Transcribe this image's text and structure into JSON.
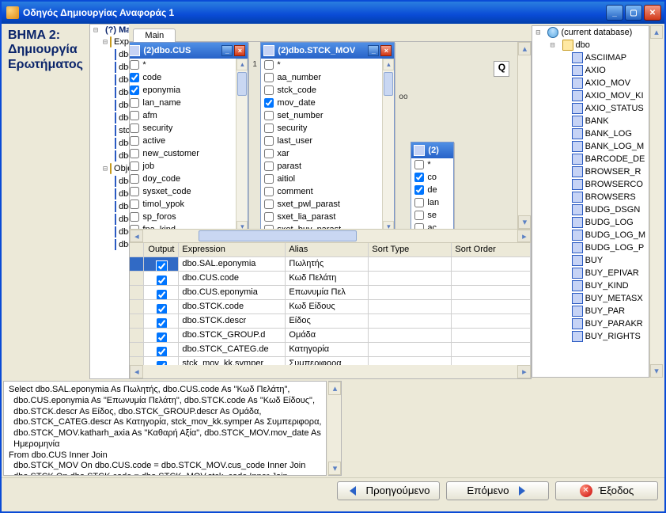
{
  "window": {
    "title": "Οδηγός Δημιουργίας Αναφοράς 1"
  },
  "wizard": {
    "step_title_line1": "BHMA 2:",
    "step_title_line2": "Δημιουργία",
    "step_title_line3": "Ερωτήματος"
  },
  "mid_tree": {
    "root": "(?) Main",
    "items": [
      {
        "indent": 1,
        "icon": "fold",
        "label": "Express"
      },
      {
        "indent": 2,
        "icon": "tab",
        "label": "dbo"
      },
      {
        "indent": 2,
        "icon": "tab",
        "label": "dbo"
      },
      {
        "indent": 2,
        "icon": "tab",
        "label": "dbo"
      },
      {
        "indent": 2,
        "icon": "tab",
        "label": "dbo"
      },
      {
        "indent": 2,
        "icon": "tab",
        "label": "dbo"
      },
      {
        "indent": 2,
        "icon": "tab",
        "label": "dbo"
      },
      {
        "indent": 2,
        "icon": "tab",
        "label": "stck"
      },
      {
        "indent": 2,
        "icon": "tab",
        "label": "dbo"
      },
      {
        "indent": 2,
        "icon": "tab",
        "label": "dbo"
      },
      {
        "indent": 1,
        "icon": "fold",
        "label": "Object"
      },
      {
        "indent": 2,
        "icon": "tab",
        "label": "dbo"
      },
      {
        "indent": 2,
        "icon": "tab",
        "label": "dbo"
      },
      {
        "indent": 2,
        "icon": "tab",
        "label": "dbo"
      },
      {
        "indent": 2,
        "icon": "tab",
        "label": "dbo"
      },
      {
        "indent": 2,
        "icon": "tab",
        "label": "dbo"
      },
      {
        "indent": 2,
        "icon": "tab",
        "label": "dbo"
      }
    ]
  },
  "tab": {
    "main": "Main"
  },
  "tables": {
    "cus": {
      "title": "(2)dbo.CUS",
      "rows": [
        {
          "c": false,
          "f": "*"
        },
        {
          "c": true,
          "f": "code"
        },
        {
          "c": true,
          "f": "eponymia"
        },
        {
          "c": false,
          "f": "lan_name"
        },
        {
          "c": false,
          "f": "afm"
        },
        {
          "c": false,
          "f": "security"
        },
        {
          "c": false,
          "f": "active"
        },
        {
          "c": false,
          "f": "new_customer"
        },
        {
          "c": false,
          "f": "job"
        },
        {
          "c": false,
          "f": "doy_code"
        },
        {
          "c": false,
          "f": "sysxet_code"
        },
        {
          "c": false,
          "f": "timol_ypok"
        },
        {
          "c": false,
          "f": "sp_foros"
        },
        {
          "c": false,
          "f": "fpa_kind"
        }
      ]
    },
    "stck_mov": {
      "title": "(2)dbo.STCK_MOV",
      "rows": [
        {
          "c": false,
          "f": "*"
        },
        {
          "c": false,
          "f": "aa_number"
        },
        {
          "c": false,
          "f": "stck_code"
        },
        {
          "c": true,
          "f": "mov_date"
        },
        {
          "c": false,
          "f": "set_number"
        },
        {
          "c": false,
          "f": "security"
        },
        {
          "c": false,
          "f": "last_user"
        },
        {
          "c": false,
          "f": "xar"
        },
        {
          "c": false,
          "f": "parast"
        },
        {
          "c": false,
          "f": "aitiol"
        },
        {
          "c": false,
          "f": "comment"
        },
        {
          "c": false,
          "f": "sxet_pwl_parast"
        },
        {
          "c": false,
          "f": "sxet_lia_parast"
        },
        {
          "c": false,
          "f": "sxet_buy_parast"
        }
      ]
    },
    "third": {
      "title": "(2)",
      "rows": [
        {
          "c": false,
          "f": "*"
        },
        {
          "c": true,
          "f": "co"
        },
        {
          "c": true,
          "f": "de"
        },
        {
          "c": false,
          "f": "lan"
        },
        {
          "c": false,
          "f": "se"
        },
        {
          "c": false,
          "f": "ac"
        }
      ]
    }
  },
  "relations": {
    "r1": "1",
    "r2": "oo",
    "r3": "1"
  },
  "grid": {
    "headers": {
      "output": "Output",
      "expression": "Expression",
      "alias": "Alias",
      "sort_type": "Sort Type",
      "sort_order": "Sort Order"
    },
    "rows": [
      {
        "out": true,
        "exp": "dbo.SAL.eponymia",
        "alias": "Πωλητής",
        "sel": true
      },
      {
        "out": true,
        "exp": "dbo.CUS.code",
        "alias": "Κωδ Πελάτη"
      },
      {
        "out": true,
        "exp": "dbo.CUS.eponymia",
        "alias": "Επωνυμία Πελ"
      },
      {
        "out": true,
        "exp": "dbo.STCK.code",
        "alias": "Κωδ Είδους"
      },
      {
        "out": true,
        "exp": "dbo.STCK.descr",
        "alias": "Είδος"
      },
      {
        "out": true,
        "exp": "dbo.STCK_GROUP.d",
        "alias": "Ομάδα"
      },
      {
        "out": true,
        "exp": "dbo.STCK_CATEG.de",
        "alias": "Κατηγορία"
      },
      {
        "out": true,
        "exp": "stck_mov_kk.symper",
        "alias": "Συμπεριφορα"
      }
    ]
  },
  "sql": "Select dbo.SAL.eponymia As Πωλητής, dbo.CUS.code As \"Κωδ Πελάτη\",\n  dbo.CUS.eponymia As \"Επωνυμία Πελάτη\", dbo.STCK.code As \"Κωδ Είδους\",\n  dbo.STCK.descr As Είδος, dbo.STCK_GROUP.descr As Ομάδα,\n  dbo.STCK_CATEG.descr As Κατηγορία, stck_mov_kk.symper As Συμπεριφορα,\n  dbo.STCK_MOV.katharh_axia As \"Καθαρή Αξία\", dbo.STCK_MOV.mov_date As\n  Ημερομηνία\nFrom dbo.CUS Inner Join\n  dbo.STCK_MOV On dbo.CUS.code = dbo.STCK_MOV.cus_code Inner Join\n  dbo.STCK On dbo.STCK.code = dbo.STCK_MOV.stck_code Inner Join",
  "db_tree": {
    "root": "(current database)",
    "db": "dbo",
    "tables": [
      "ASCIIMAP",
      "AXIO",
      "AXIO_MOV",
      "AXIO_MOV_KI",
      "AXIO_STATUS",
      "BANK",
      "BANK_LOG",
      "BANK_LOG_M",
      "BARCODE_DE",
      "BROWSER_R",
      "BROWSERCO",
      "BROWSERS",
      "BUDG_DSGN",
      "BUDG_LOG",
      "BUDG_LOG_M",
      "BUDG_LOG_P",
      "BUY",
      "BUY_EPIVAR",
      "BUY_KIND",
      "BUY_METASX",
      "BUY_PAR",
      "BUY_PARAKR",
      "BUY_RIGHTS"
    ]
  },
  "buttons": {
    "prev": "Προηγούμενο",
    "next": "Επόμενο",
    "exit": "Έξοδος"
  },
  "q_button": "Q"
}
